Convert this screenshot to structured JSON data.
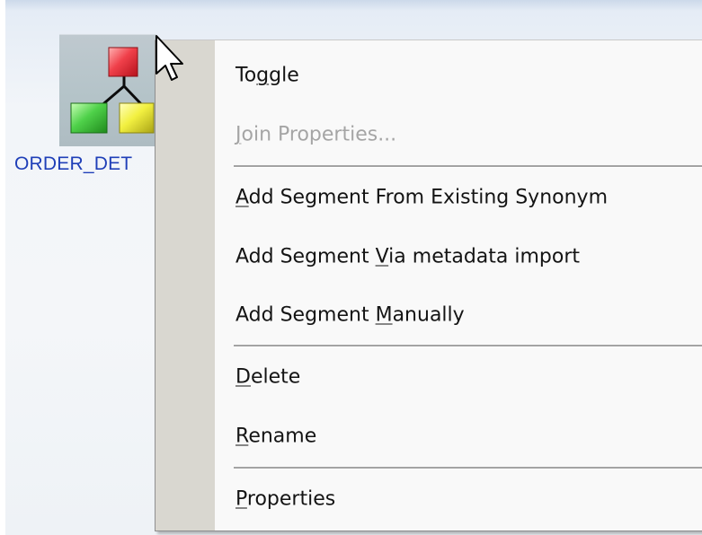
{
  "canvas": {
    "node": {
      "icon": "segment-hierarchy-icon",
      "label": "ORDER_DET"
    }
  },
  "context_menu": {
    "items": [
      {
        "id": "toggle",
        "pre": "To",
        "key": "g",
        "post": "gle",
        "enabled": true
      },
      {
        "id": "join-properties",
        "pre": "",
        "key": "J",
        "post": "oin Properties...",
        "enabled": false
      },
      {
        "id": "add-segment-existing-synonym",
        "pre": "",
        "key": "A",
        "post": "dd Segment From Existing Synonym",
        "enabled": true
      },
      {
        "id": "add-segment-metadata-import",
        "pre": "Add Segment ",
        "key": "V",
        "post": "ia metadata import",
        "enabled": true
      },
      {
        "id": "add-segment-manually",
        "pre": "Add Segment ",
        "key": "M",
        "post": "anually",
        "enabled": true
      },
      {
        "id": "delete",
        "pre": "",
        "key": "D",
        "post": "elete",
        "enabled": true
      },
      {
        "id": "rename",
        "pre": "",
        "key": "R",
        "post": "ename",
        "enabled": true
      },
      {
        "id": "properties",
        "pre": "",
        "key": "P",
        "post": "roperties",
        "enabled": true
      }
    ]
  },
  "cursor": {
    "icon": "arrow-pointer-icon"
  },
  "colors": {
    "menu_background": "#f9f9f9",
    "menu_gutter": "#d9d7d0",
    "disabled_text": "#a5a5a5",
    "node_label": "#1f3fb8"
  }
}
